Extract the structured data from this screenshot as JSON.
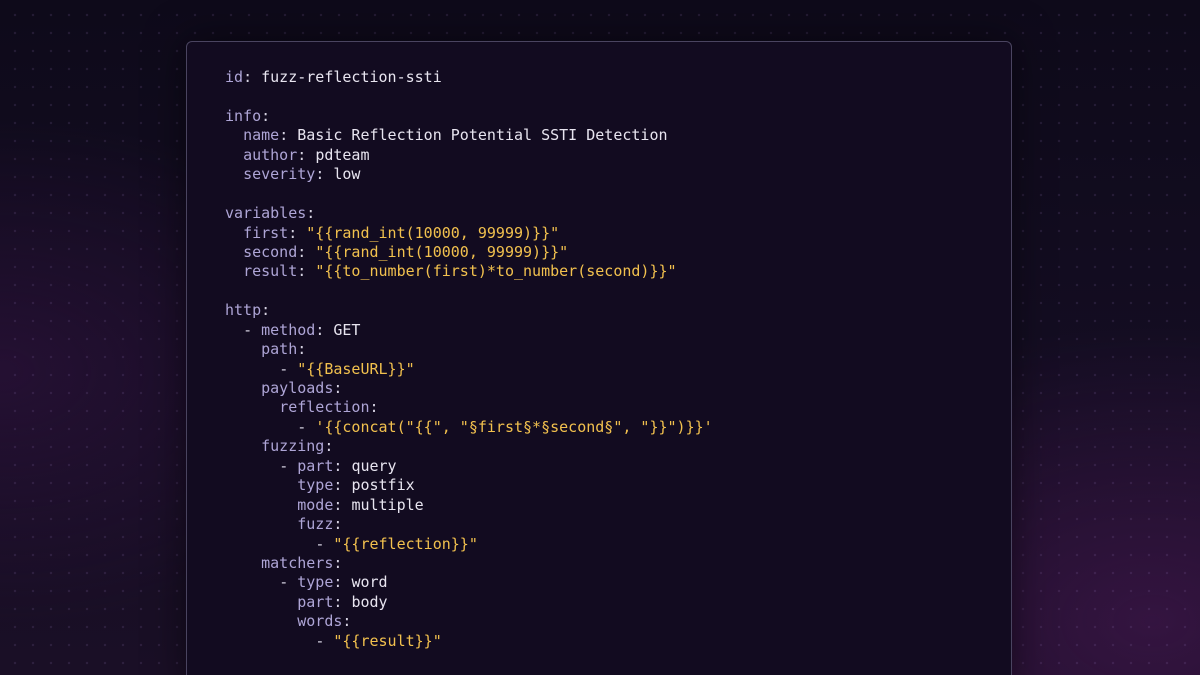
{
  "colors": {
    "background": "#120b20",
    "key": "#aea5d6",
    "plain_value": "#e8e5f0",
    "string_value": "#f2c14e",
    "border": "#4a4460"
  },
  "code_lines": [
    {
      "indent": "",
      "prefix": "",
      "key": "id",
      "sep": ": ",
      "value": "fuzz-reflection-ssti",
      "value_kind": "plain"
    },
    {
      "indent": "",
      "prefix": "",
      "key": "",
      "sep": "",
      "value": "",
      "value_kind": "plain"
    },
    {
      "indent": "",
      "prefix": "",
      "key": "info",
      "sep": ":",
      "value": "",
      "value_kind": "plain"
    },
    {
      "indent": "  ",
      "prefix": "",
      "key": "name",
      "sep": ": ",
      "value": "Basic Reflection Potential SSTI Detection",
      "value_kind": "plain"
    },
    {
      "indent": "  ",
      "prefix": "",
      "key": "author",
      "sep": ": ",
      "value": "pdteam",
      "value_kind": "plain"
    },
    {
      "indent": "  ",
      "prefix": "",
      "key": "severity",
      "sep": ": ",
      "value": "low",
      "value_kind": "plain"
    },
    {
      "indent": "",
      "prefix": "",
      "key": "",
      "sep": "",
      "value": "",
      "value_kind": "plain"
    },
    {
      "indent": "",
      "prefix": "",
      "key": "variables",
      "sep": ":",
      "value": "",
      "value_kind": "plain"
    },
    {
      "indent": "  ",
      "prefix": "",
      "key": "first",
      "sep": ": ",
      "value": "\"{{rand_int(10000, 99999)}}\"",
      "value_kind": "string"
    },
    {
      "indent": "  ",
      "prefix": "",
      "key": "second",
      "sep": ": ",
      "value": "\"{{rand_int(10000, 99999)}}\"",
      "value_kind": "string"
    },
    {
      "indent": "  ",
      "prefix": "",
      "key": "result",
      "sep": ": ",
      "value": "\"{{to_number(first)*to_number(second)}}\"",
      "value_kind": "string"
    },
    {
      "indent": "",
      "prefix": "",
      "key": "",
      "sep": "",
      "value": "",
      "value_kind": "plain"
    },
    {
      "indent": "",
      "prefix": "",
      "key": "http",
      "sep": ":",
      "value": "",
      "value_kind": "plain"
    },
    {
      "indent": "  ",
      "prefix": "- ",
      "key": "method",
      "sep": ": ",
      "value": "GET",
      "value_kind": "plain"
    },
    {
      "indent": "    ",
      "prefix": "",
      "key": "path",
      "sep": ":",
      "value": "",
      "value_kind": "plain"
    },
    {
      "indent": "      ",
      "prefix": "- ",
      "key": "",
      "sep": "",
      "value": "\"{{BaseURL}}\"",
      "value_kind": "string"
    },
    {
      "indent": "    ",
      "prefix": "",
      "key": "payloads",
      "sep": ":",
      "value": "",
      "value_kind": "plain"
    },
    {
      "indent": "      ",
      "prefix": "",
      "key": "reflection",
      "sep": ":",
      "value": "",
      "value_kind": "plain"
    },
    {
      "indent": "        ",
      "prefix": "- ",
      "key": "",
      "sep": "",
      "value": "'{{concat(\"{{\", \"§first§*§second§\", \"}}\")}}'",
      "value_kind": "string"
    },
    {
      "indent": "    ",
      "prefix": "",
      "key": "fuzzing",
      "sep": ":",
      "value": "",
      "value_kind": "plain"
    },
    {
      "indent": "      ",
      "prefix": "- ",
      "key": "part",
      "sep": ": ",
      "value": "query",
      "value_kind": "plain"
    },
    {
      "indent": "        ",
      "prefix": "",
      "key": "type",
      "sep": ": ",
      "value": "postfix",
      "value_kind": "plain"
    },
    {
      "indent": "        ",
      "prefix": "",
      "key": "mode",
      "sep": ": ",
      "value": "multiple",
      "value_kind": "plain"
    },
    {
      "indent": "        ",
      "prefix": "",
      "key": "fuzz",
      "sep": ":",
      "value": "",
      "value_kind": "plain"
    },
    {
      "indent": "          ",
      "prefix": "- ",
      "key": "",
      "sep": "",
      "value": "\"{{reflection}}\"",
      "value_kind": "string"
    },
    {
      "indent": "    ",
      "prefix": "",
      "key": "matchers",
      "sep": ":",
      "value": "",
      "value_kind": "plain"
    },
    {
      "indent": "      ",
      "prefix": "- ",
      "key": "type",
      "sep": ": ",
      "value": "word",
      "value_kind": "plain"
    },
    {
      "indent": "        ",
      "prefix": "",
      "key": "part",
      "sep": ": ",
      "value": "body",
      "value_kind": "plain"
    },
    {
      "indent": "        ",
      "prefix": "",
      "key": "words",
      "sep": ":",
      "value": "",
      "value_kind": "plain"
    },
    {
      "indent": "          ",
      "prefix": "- ",
      "key": "",
      "sep": "",
      "value": "\"{{result}}\"",
      "value_kind": "string"
    }
  ]
}
